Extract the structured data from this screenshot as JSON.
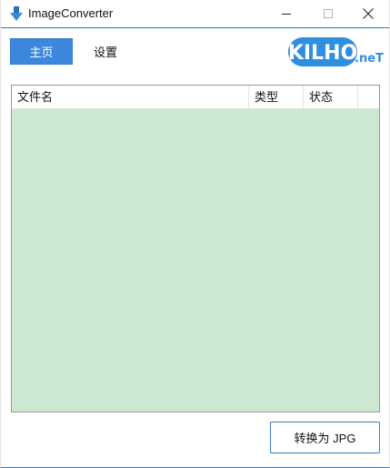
{
  "window": {
    "title": "ImageConverter",
    "icon": "download-arrow-icon",
    "controls": {
      "minimize": "minimize-icon",
      "maximize": "maximize-icon",
      "close": "close-icon"
    }
  },
  "nav": {
    "home_label": "主页",
    "settings_label": "设置",
    "active": "home"
  },
  "logo": {
    "main_text": "KILHO",
    "suffix_text": ".neT"
  },
  "file_list": {
    "columns": [
      "文件名",
      "类型",
      "状态"
    ],
    "rows": []
  },
  "actions": {
    "convert_label": "转换为 JPG"
  },
  "colors": {
    "accent": "#3d87dd",
    "list_background": "#cde8d1",
    "titlebar_border": "#2d7cc7",
    "logo_blue": "#2e8ee0"
  }
}
